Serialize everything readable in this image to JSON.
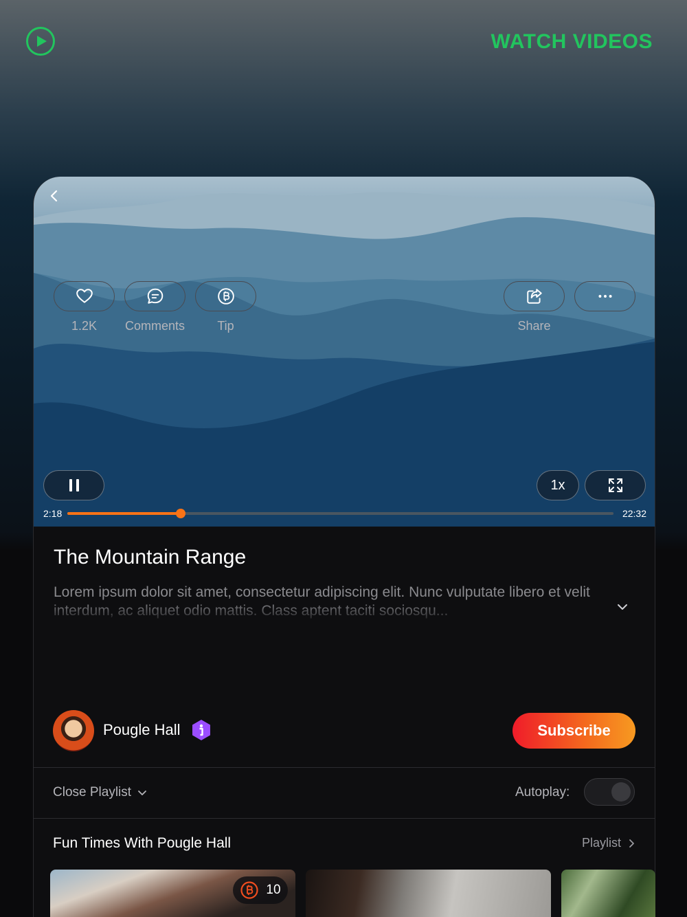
{
  "header": {
    "app_title": "WATCH VIDEOS",
    "logo_icon": "play-circle-icon",
    "accent_color": "#22c55e"
  },
  "player": {
    "back_icon": "chevron-left-icon",
    "pause_icon": "pause-icon",
    "speed_label": "1x",
    "fullscreen_icon": "expand-icon",
    "current_time": "2:18",
    "total_time": "22:32",
    "progress_fraction": 0.208,
    "progress_color": "#f97316"
  },
  "video": {
    "title": "The Mountain Range",
    "description": "Lorem ipsum dolor sit amet, consectetur adipiscing elit. Nunc vulputate libero et velit interdum, ac aliquet odio mattis. Class aptent taciti sociosqu...",
    "expand_icon": "chevron-down-icon"
  },
  "actions": {
    "like": {
      "label": "1.2K",
      "icon": "heart-icon"
    },
    "comments": {
      "label": "Comments",
      "icon": "comment-icon"
    },
    "tip": {
      "label": "Tip",
      "icon": "coin-b-icon"
    },
    "share": {
      "label": "Share",
      "icon": "share-icon"
    },
    "more": {
      "label": "",
      "icon": "more-horizontal-icon"
    }
  },
  "channel": {
    "name": "Pougle Hall",
    "badge_icon": "verified-badge-icon",
    "subscribe_label": "Subscribe"
  },
  "playlist_bar": {
    "close_label": "Close Playlist",
    "autoplay_label": "Autoplay:",
    "autoplay_on": false
  },
  "playlist": {
    "title": "Fun Times With Pougle Hall",
    "link_label": "Playlist",
    "items": [
      {
        "tip_count": "10"
      },
      {},
      {}
    ]
  }
}
